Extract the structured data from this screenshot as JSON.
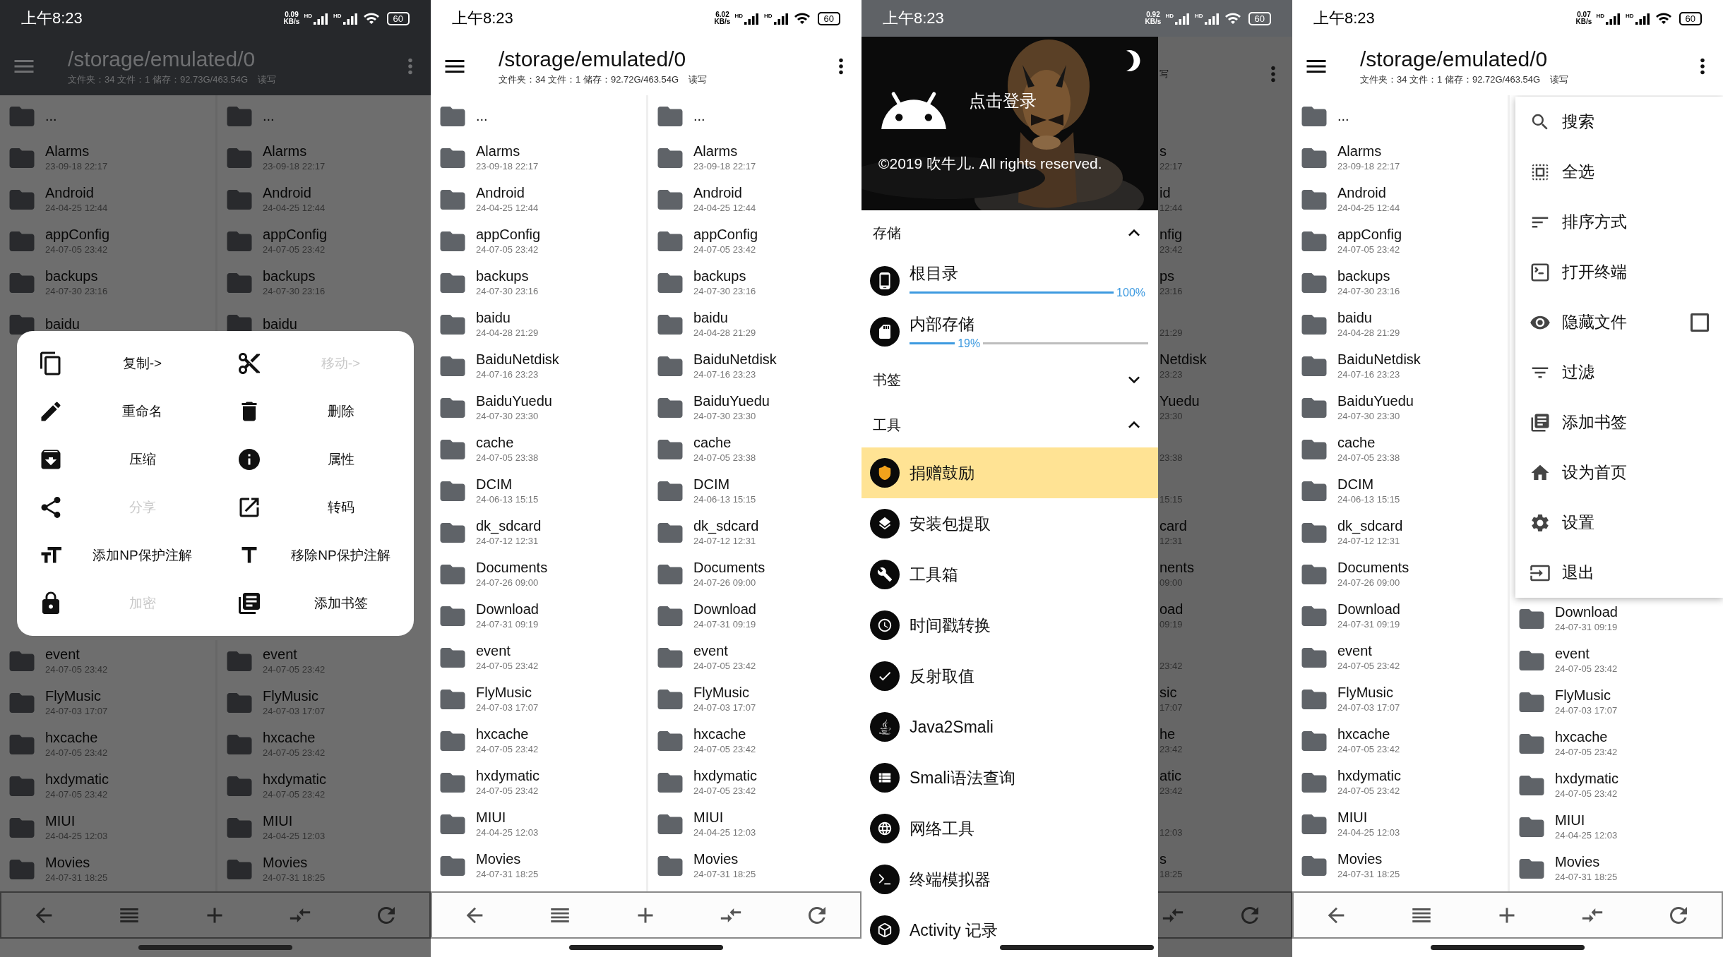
{
  "phones": [
    {
      "kind": "dialog",
      "dimmed": true,
      "status": {
        "kind": "dark",
        "time": "上午8:23",
        "speed": "0.09",
        "speed_unit": "KB/s",
        "networks": [
          "HD",
          "HD"
        ],
        "battery": "60"
      },
      "appbar": {
        "title": "/storage/emulated/0",
        "info": "文件夹：34 文件：1  储存：92.73G/463.54G",
        "mode": "读写"
      },
      "panes_top": [
        {
          "rows": [
            {
              "name": "..."
            },
            {
              "name": "Alarms",
              "date": "23-09-18 22:17"
            },
            {
              "name": "Android",
              "date": "24-04-25 12:44"
            },
            {
              "name": "appConfig",
              "date": "24-07-05 23:42"
            },
            {
              "name": "backups",
              "date": "24-07-30 23:16"
            },
            {
              "name": "baidu"
            }
          ]
        },
        {
          "rows": [
            {
              "name": "..."
            },
            {
              "name": "Alarms",
              "date": "23-09-18 22:17"
            },
            {
              "name": "Android",
              "date": "24-04-25 12:44"
            },
            {
              "name": "appConfig",
              "date": "24-07-05 23:42"
            },
            {
              "name": "backups",
              "date": "24-07-30 23:16"
            },
            {
              "name": "baidu"
            }
          ]
        }
      ],
      "dialog": {
        "items": [
          {
            "label": "复制->",
            "disabled": false
          },
          {
            "label": "移动->",
            "disabled": true
          },
          {
            "label": "重命名",
            "disabled": false
          },
          {
            "label": "删除",
            "disabled": false
          },
          {
            "label": "压缩",
            "disabled": false
          },
          {
            "label": "属性",
            "disabled": false
          },
          {
            "label": "分享",
            "disabled": true
          },
          {
            "label": "转码",
            "disabled": false
          },
          {
            "label": "添加NP保护注解",
            "disabled": false
          },
          {
            "label": "移除NP保护注解",
            "disabled": false
          },
          {
            "label": "加密",
            "disabled": true
          },
          {
            "label": "添加书签",
            "disabled": false
          }
        ]
      },
      "panes_bottom": [
        {
          "rows": [
            {
              "name": "event",
              "date": "24-07-05 23:42"
            },
            {
              "name": "FlyMusic",
              "date": "24-07-03 17:07"
            },
            {
              "name": "hxcache",
              "date": "24-07-05 23:42"
            },
            {
              "name": "hxdymatic",
              "date": "24-07-05 23:42"
            },
            {
              "name": "MIUI",
              "date": "24-04-25 12:03"
            },
            {
              "name": "Movies",
              "date": "24-07-31 18:25"
            }
          ]
        },
        {
          "rows": [
            {
              "name": "event",
              "date": "24-07-05 23:42"
            },
            {
              "name": "FlyMusic",
              "date": "24-07-03 17:07"
            },
            {
              "name": "hxcache",
              "date": "24-07-05 23:42"
            },
            {
              "name": "hxdymatic",
              "date": "24-07-05 23:42"
            },
            {
              "name": "MIUI",
              "date": "24-04-25 12:03"
            },
            {
              "name": "Movies",
              "date": "24-07-31 18:25"
            }
          ]
        }
      ]
    },
    {
      "kind": "list",
      "dimmed": false,
      "status": {
        "kind": "light",
        "time": "上午8:23",
        "speed": "6.02",
        "speed_unit": "KB/s",
        "networks": [
          "HD",
          "HD"
        ],
        "battery": "60"
      },
      "appbar": {
        "title": "/storage/emulated/0",
        "info": "文件夹：34 文件：1  储存：92.72G/463.54G",
        "mode": "读写"
      },
      "panes": [
        {
          "rows": [
            {
              "name": "..."
            },
            {
              "name": "Alarms",
              "date": "23-09-18 22:17"
            },
            {
              "name": "Android",
              "date": "24-04-25 12:44"
            },
            {
              "name": "appConfig",
              "date": "24-07-05 23:42"
            },
            {
              "name": "backups",
              "date": "24-07-30 23:16"
            },
            {
              "name": "baidu",
              "date": "24-04-28 21:29"
            },
            {
              "name": "BaiduNetdisk",
              "date": "24-07-16 23:23"
            },
            {
              "name": "BaiduYuedu",
              "date": "24-07-30 23:30"
            },
            {
              "name": "cache",
              "date": "24-07-05 23:38"
            },
            {
              "name": "DCIM",
              "date": "24-06-13 15:15"
            },
            {
              "name": "dk_sdcard",
              "date": "24-07-12 12:31"
            },
            {
              "name": "Documents",
              "date": "24-07-26 09:00"
            },
            {
              "name": "Download",
              "date": "24-07-31 09:19"
            },
            {
              "name": "event",
              "date": "24-07-05 23:42"
            },
            {
              "name": "FlyMusic",
              "date": "24-07-03 17:07"
            },
            {
              "name": "hxcache",
              "date": "24-07-05 23:42"
            },
            {
              "name": "hxdymatic",
              "date": "24-07-05 23:42"
            },
            {
              "name": "MIUI",
              "date": "24-04-25 12:03"
            },
            {
              "name": "Movies",
              "date": "24-07-31 18:25"
            }
          ]
        },
        {
          "rows": [
            {
              "name": "..."
            },
            {
              "name": "Alarms",
              "date": "23-09-18 22:17"
            },
            {
              "name": "Android",
              "date": "24-04-25 12:44"
            },
            {
              "name": "appConfig",
              "date": "24-07-05 23:42"
            },
            {
              "name": "backups",
              "date": "24-07-30 23:16"
            },
            {
              "name": "baidu",
              "date": "24-04-28 21:29"
            },
            {
              "name": "BaiduNetdisk",
              "date": "24-07-16 23:23"
            },
            {
              "name": "BaiduYuedu",
              "date": "24-07-30 23:30"
            },
            {
              "name": "cache",
              "date": "24-07-05 23:38"
            },
            {
              "name": "DCIM",
              "date": "24-06-13 15:15"
            },
            {
              "name": "dk_sdcard",
              "date": "24-07-12 12:31"
            },
            {
              "name": "Documents",
              "date": "24-07-26 09:00"
            },
            {
              "name": "Download",
              "date": "24-07-31 09:19"
            },
            {
              "name": "event",
              "date": "24-07-05 23:42"
            },
            {
              "name": "FlyMusic",
              "date": "24-07-03 17:07"
            },
            {
              "name": "hxcache",
              "date": "24-07-05 23:42"
            },
            {
              "name": "hxdymatic",
              "date": "24-07-05 23:42"
            },
            {
              "name": "MIUI",
              "date": "24-04-25 12:03"
            },
            {
              "name": "Movies",
              "date": "24-07-31 18:25"
            }
          ]
        }
      ]
    },
    {
      "kind": "drawer",
      "dimmed": true,
      "status": {
        "kind": "scrim",
        "time": "上午8:23",
        "speed": "0.92",
        "speed_unit": "KB/s",
        "networks": [
          "HD",
          "HD"
        ],
        "battery": "60"
      },
      "drawer": {
        "login": "点击登录",
        "copyright": "©2019 吹牛儿. All rights reserved.",
        "sections": [
          {
            "title": "存储",
            "expanded": true,
            "items": [
              {
                "kind": "storage",
                "label": "根目录",
                "percent": "100%",
                "level": 1
              },
              {
                "kind": "storage",
                "label": "内部存储",
                "percent": "19%",
                "level": 0.19
              }
            ]
          },
          {
            "title": "书签",
            "expanded": false
          },
          {
            "title": "工具",
            "expanded": true,
            "items": [
              {
                "kind": "tool",
                "label": "捐赠鼓励",
                "selected": true
              },
              {
                "kind": "tool",
                "label": "安装包提取",
                "selected": false
              },
              {
                "kind": "tool",
                "label": "工具箱",
                "selected": false
              },
              {
                "kind": "tool",
                "label": "时间戳转换",
                "selected": false
              },
              {
                "kind": "tool",
                "label": "反射取值",
                "selected": false
              },
              {
                "kind": "tool",
                "label": "Java2Smali",
                "selected": false
              },
              {
                "kind": "tool",
                "label": "Smali语法查询",
                "selected": false
              },
              {
                "kind": "tool",
                "label": "网络工具",
                "selected": false
              },
              {
                "kind": "tool",
                "label": "终端模拟器",
                "selected": false
              },
              {
                "kind": "tool",
                "label": "Activity 记录",
                "selected": false
              }
            ]
          }
        ]
      },
      "background": {
        "mode": "写",
        "rows": [
          {
            "name": "s",
            "date": "22:17"
          },
          {
            "name": "id",
            "date": "12:44"
          },
          {
            "name": "nfig",
            "date": "23:42"
          },
          {
            "name": "ps",
            "date": "23:16"
          },
          {
            "date": "21:29"
          },
          {
            "name": "Netdisk",
            "date": "23:23"
          },
          {
            "name": "Yuedu",
            "date": "23:30"
          },
          {
            "date": "23:38"
          },
          {
            "date": "15:15"
          },
          {
            "name": "card",
            "date": "12:31"
          },
          {
            "name": "nents",
            "date": "09:00"
          },
          {
            "name": "oad",
            "date": "09:19"
          },
          {
            "date": "23:42"
          },
          {
            "name": "sic",
            "date": "17:07"
          },
          {
            "name": "he",
            "date": "23:42"
          },
          {
            "name": "atic",
            "date": "23:42"
          },
          {
            "date": "12:03"
          },
          {
            "name": "s",
            "date": "18:25"
          }
        ]
      }
    },
    {
      "kind": "menu",
      "dimmed": false,
      "status": {
        "kind": "light",
        "time": "上午8:23",
        "speed": "0.07",
        "speed_unit": "KB/s",
        "networks": [
          "HD",
          "HD"
        ],
        "battery": "60"
      },
      "appbar": {
        "title": "/storage/emulated/0",
        "info": "文件夹：34 文件：1  储存：92.72G/463.54G",
        "mode": "读写"
      },
      "panes": [
        {
          "rows": [
            {
              "name": "..."
            },
            {
              "name": "Alarms",
              "date": "23-09-18 22:17"
            },
            {
              "name": "Android",
              "date": "24-04-25 12:44"
            },
            {
              "name": "appConfig",
              "date": "24-07-05 23:42"
            },
            {
              "name": "backups",
              "date": "24-07-30 23:16"
            },
            {
              "name": "baidu",
              "date": "24-04-28 21:29"
            },
            {
              "name": "BaiduNetdisk",
              "date": "24-07-16 23:23"
            },
            {
              "name": "BaiduYuedu",
              "date": "24-07-30 23:30"
            },
            {
              "name": "cache",
              "date": "24-07-05 23:38"
            },
            {
              "name": "DCIM",
              "date": "24-06-13 15:15"
            },
            {
              "name": "dk_sdcard",
              "date": "24-07-12 12:31"
            },
            {
              "name": "Documents",
              "date": "24-07-26 09:00"
            },
            {
              "name": "Download",
              "date": "24-07-31 09:19"
            },
            {
              "name": "event",
              "date": "24-07-05 23:42"
            },
            {
              "name": "FlyMusic",
              "date": "24-07-03 17:07"
            },
            {
              "name": "hxcache",
              "date": "24-07-05 23:42"
            },
            {
              "name": "hxdymatic",
              "date": "24-07-05 23:42"
            },
            {
              "name": "MIUI",
              "date": "24-04-25 12:03"
            },
            {
              "name": "Movies",
              "date": "24-07-31 18:25"
            }
          ]
        },
        {
          "rows": [
            {
              "name": "Download",
              "date": "24-07-31 09:19"
            },
            {
              "name": "event",
              "date": "24-07-05 23:42"
            },
            {
              "name": "FlyMusic",
              "date": "24-07-03 17:07"
            },
            {
              "name": "hxcache",
              "date": "24-07-05 23:42"
            },
            {
              "name": "hxdymatic",
              "date": "24-07-05 23:42"
            },
            {
              "name": "MIUI",
              "date": "24-04-25 12:03"
            },
            {
              "name": "Movies",
              "date": "24-07-31 18:25"
            }
          ]
        }
      ],
      "menu": {
        "items": [
          {
            "kind": "plain",
            "label": "搜索"
          },
          {
            "kind": "plain",
            "label": "全选"
          },
          {
            "kind": "plain",
            "label": "排序方式"
          },
          {
            "kind": "plain",
            "label": "打开终端"
          },
          {
            "kind": "check",
            "label": "隐藏文件",
            "checked": false
          },
          {
            "kind": "plain",
            "label": "过滤"
          },
          {
            "kind": "plain",
            "label": "添加书签"
          },
          {
            "kind": "plain",
            "label": "设为首页"
          },
          {
            "kind": "plain",
            "label": "设置"
          },
          {
            "kind": "plain",
            "label": "退出"
          }
        ]
      }
    }
  ]
}
